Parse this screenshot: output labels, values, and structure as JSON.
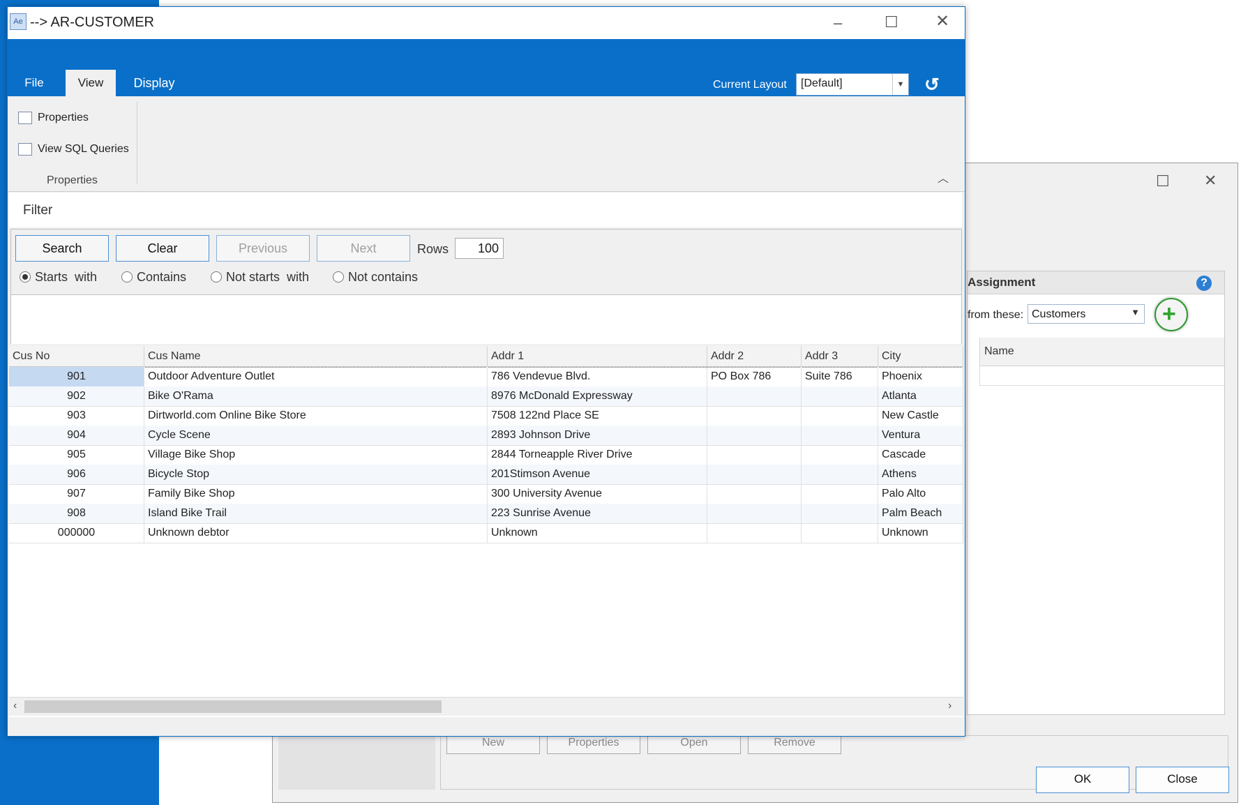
{
  "background_dialog": {
    "section_title": "Assignment",
    "from_label": "from these:",
    "source_value": "Customers",
    "grid_column": "Name",
    "buttons": [
      "New",
      "Properties",
      "Open",
      "Remove"
    ],
    "ok_label": "OK",
    "close_label": "Close"
  },
  "window": {
    "title": "--> AR-CUSTOMER",
    "icon_text": "Ae"
  },
  "ribbon": {
    "tabs": [
      "File",
      "View",
      "Display"
    ],
    "current_layout_label": "Current Layout",
    "current_layout_value": "[Default]",
    "items": [
      "Properties",
      "View SQL Queries"
    ],
    "group_label": "Properties"
  },
  "filter": {
    "title": "Filter",
    "search_label": "Search",
    "clear_label": "Clear",
    "previous_label": "Previous",
    "next_label": "Next",
    "rows_label": "Rows",
    "rows_value": "100",
    "modes": [
      "Starts  with",
      "Contains",
      "Not starts  with",
      "Not contains"
    ],
    "selected_mode": "Starts  with"
  },
  "grid": {
    "columns": [
      "Cus No",
      "Cus Name",
      "Addr 1",
      "Addr 2",
      "Addr 3",
      "City"
    ],
    "rows": [
      [
        "901",
        "Outdoor Adventure Outlet",
        "786 Vendevue Blvd.",
        "PO Box 786",
        "Suite 786",
        "Phoenix"
      ],
      [
        "902",
        "Bike O'Rama",
        "8976 McDonald Expressway",
        "",
        "",
        "Atlanta"
      ],
      [
        "903",
        "Dirtworld.com Online Bike Store",
        "7508 122nd Place SE",
        "",
        "",
        "New Castle"
      ],
      [
        "904",
        "Cycle Scene",
        "2893 Johnson Drive",
        "",
        "",
        "Ventura"
      ],
      [
        "905",
        "Village Bike Shop",
        "2844 Torneapple River Drive",
        "",
        "",
        "Cascade"
      ],
      [
        "906",
        "Bicycle Stop",
        "201Stimson Avenue",
        "",
        "",
        "Athens"
      ],
      [
        "907",
        "Family Bike Shop",
        "300 University Avenue",
        "",
        "",
        "Palo Alto"
      ],
      [
        "908",
        "Island Bike Trail",
        "223 Sunrise Avenue",
        "",
        "",
        "Palm Beach"
      ],
      [
        "000000",
        "Unknown debtor",
        "Unknown",
        "",
        "",
        "Unknown"
      ]
    ]
  },
  "colors": {
    "accent": "#0a6fc8",
    "add_green": "#2fa52f",
    "selection": "#c5d9f1"
  }
}
